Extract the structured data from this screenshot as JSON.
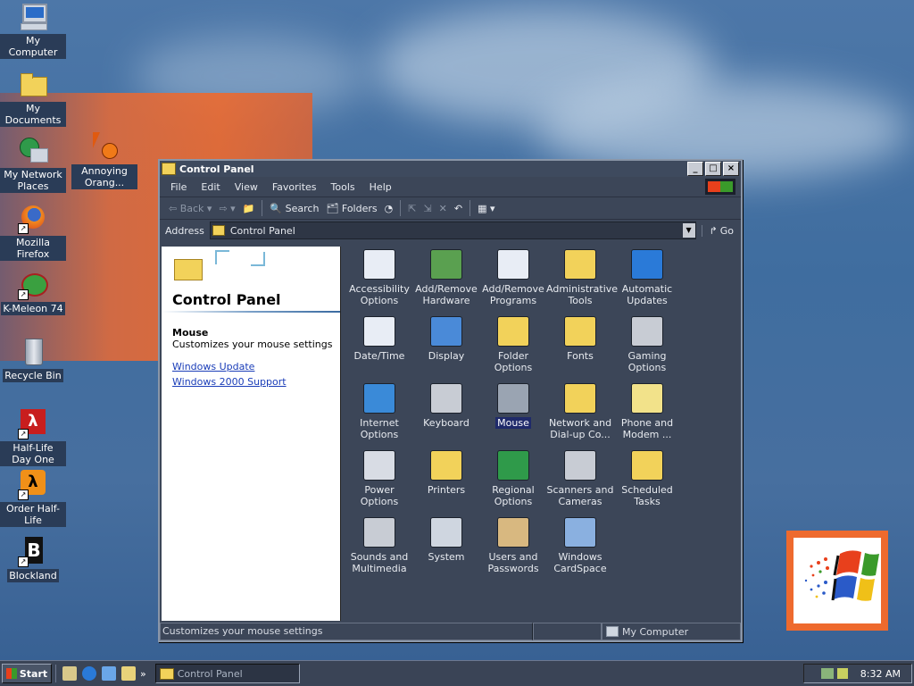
{
  "desktop": {
    "icons": [
      {
        "label": "My Computer",
        "icon": "my-computer-icon"
      },
      {
        "label": "My Documents",
        "icon": "my-documents-icon"
      },
      {
        "label": "My Network Places",
        "icon": "network-places-icon"
      },
      {
        "label": "Annoying Orang...",
        "icon": "annoying-orange-icon"
      },
      {
        "label": "Mozilla Firefox",
        "icon": "firefox-icon"
      },
      {
        "label": "K-Meleon 74",
        "icon": "k-meleon-icon"
      },
      {
        "label": "Recycle Bin",
        "icon": "recycle-bin-icon"
      },
      {
        "label": "Half-Life Day One",
        "icon": "half-life-icon"
      },
      {
        "label": "Order Half-Life",
        "icon": "half-life-order-icon"
      },
      {
        "label": "Blockland",
        "icon": "blockland-icon"
      }
    ]
  },
  "window": {
    "title": "Control Panel",
    "menu": [
      "File",
      "Edit",
      "View",
      "Favorites",
      "Tools",
      "Help"
    ],
    "toolbar": {
      "back": "Back",
      "search": "Search",
      "folders": "Folders"
    },
    "address": {
      "label": "Address",
      "value": "Control Panel",
      "go": "Go"
    },
    "left_pane": {
      "heading": "Control Panel",
      "selected_title": "Mouse",
      "selected_desc": "Customizes your mouse settings",
      "links": [
        "Windows Update",
        "Windows 2000 Support"
      ]
    },
    "items": [
      {
        "label": "Accessibility Options",
        "icon": "accessibility-icon"
      },
      {
        "label": "Add/Remove Hardware",
        "icon": "hardware-icon"
      },
      {
        "label": "Add/Remove Programs",
        "icon": "programs-icon"
      },
      {
        "label": "Administrative Tools",
        "icon": "admin-tools-icon"
      },
      {
        "label": "Automatic Updates",
        "icon": "windows-update-icon"
      },
      {
        "label": "Date/Time",
        "icon": "date-time-icon"
      },
      {
        "label": "Display",
        "icon": "display-icon"
      },
      {
        "label": "Folder Options",
        "icon": "folder-options-icon"
      },
      {
        "label": "Fonts",
        "icon": "fonts-icon"
      },
      {
        "label": "Gaming Options",
        "icon": "gaming-icon"
      },
      {
        "label": "Internet Options",
        "icon": "internet-options-icon"
      },
      {
        "label": "Keyboard",
        "icon": "keyboard-icon"
      },
      {
        "label": "Mouse",
        "icon": "mouse-icon",
        "selected": true
      },
      {
        "label": "Network and Dial-up Co...",
        "icon": "network-icon"
      },
      {
        "label": "Phone and Modem ...",
        "icon": "phone-icon"
      },
      {
        "label": "Power Options",
        "icon": "power-icon"
      },
      {
        "label": "Printers",
        "icon": "printers-icon"
      },
      {
        "label": "Regional Options",
        "icon": "regional-icon"
      },
      {
        "label": "Scanners and Cameras",
        "icon": "scanners-icon"
      },
      {
        "label": "Scheduled Tasks",
        "icon": "scheduled-tasks-icon"
      },
      {
        "label": "Sounds and Multimedia",
        "icon": "sounds-icon"
      },
      {
        "label": "System",
        "icon": "system-icon"
      },
      {
        "label": "Users and Passwords",
        "icon": "users-icon"
      },
      {
        "label": "Windows CardSpace",
        "icon": "cardspace-icon"
      }
    ],
    "status": {
      "text": "Customizes your mouse settings",
      "zone": "My Computer"
    }
  },
  "taskbar": {
    "start_label": "Start",
    "task": "Control Panel",
    "clock": "8:32 AM"
  }
}
